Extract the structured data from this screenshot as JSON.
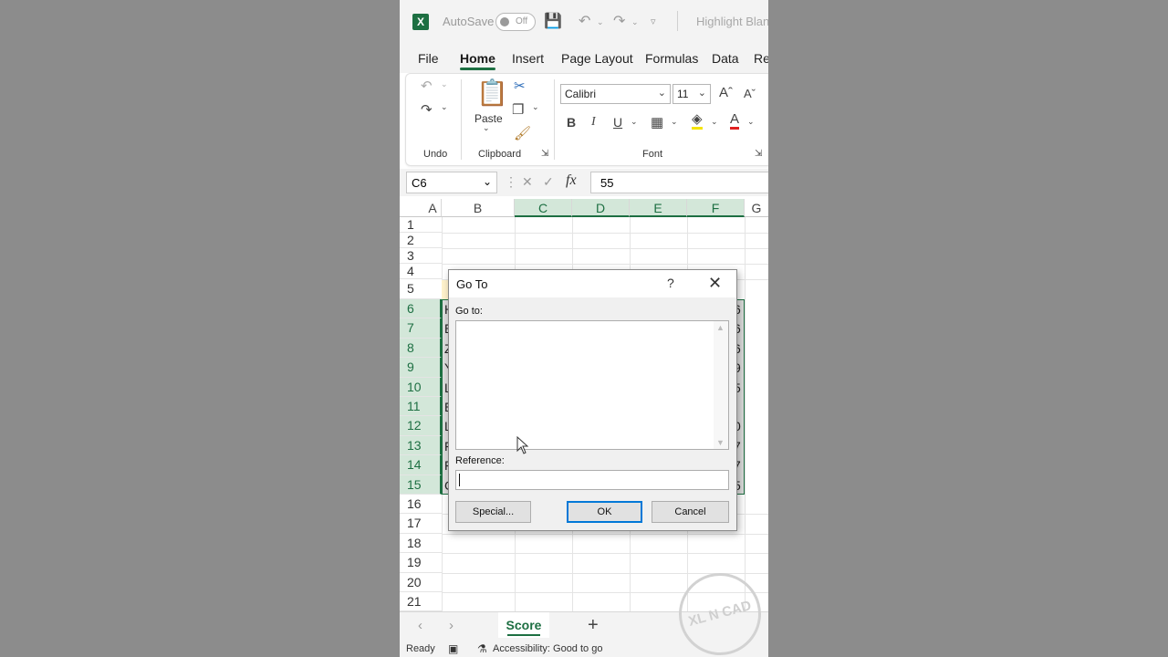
{
  "titlebar": {
    "app_icon": "excel-icon",
    "autosave_label": "AutoSave",
    "autosave_state": "Off",
    "document_title": "Highlight Blank"
  },
  "ribbon_tabs": [
    "File",
    "Home",
    "Insert",
    "Page Layout",
    "Formulas",
    "Data",
    "Re"
  ],
  "active_tab": "Home",
  "ribbon": {
    "undo_group": "Undo",
    "clipboard_group": "Clipboard",
    "paste_label": "Paste",
    "font_group": "Font",
    "font_name": "Calibri",
    "font_size": "11",
    "bold": "B",
    "italic": "I",
    "underline": "U"
  },
  "formula_bar": {
    "name_box": "C6",
    "fx": "fx",
    "value": "55"
  },
  "columns": [
    "A",
    "B",
    "C",
    "D",
    "E",
    "F",
    "G"
  ],
  "selected_columns": [
    "C",
    "D",
    "E",
    "F"
  ],
  "rows": [
    "1",
    "2",
    "3",
    "4",
    "5",
    "6",
    "7",
    "8",
    "9",
    "10",
    "11",
    "12",
    "13",
    "14",
    "15",
    "16",
    "17",
    "18",
    "19",
    "20",
    "21"
  ],
  "selected_rows": [
    "6",
    "7",
    "8",
    "9",
    "10",
    "11",
    "12",
    "13",
    "14",
    "15"
  ],
  "visible_cells": {
    "col_b": {
      "5": "",
      "6": "H",
      "7": "E",
      "8": "Z",
      "9": "Y",
      "10": "L",
      "11": "E",
      "12": "L",
      "13": "F",
      "14": "F",
      "15": "C"
    },
    "col_f": {
      "6": "6",
      "7": "6",
      "8": "6",
      "9": "9",
      "10": "5",
      "11": "",
      "12": "0",
      "13": "7",
      "14": "7",
      "15": "5"
    }
  },
  "sheet_tabs": [
    "Score"
  ],
  "active_sheet": "Score",
  "status_bar": {
    "ready": "Ready",
    "accessibility": "Accessibility: Good to go"
  },
  "watermark_text": "XL N CAD",
  "dialog": {
    "title": "Go To",
    "help": "?",
    "go_to_label": "Go to:",
    "reference_label": "Reference:",
    "reference_value": "",
    "special_button": "Special...",
    "ok_button": "OK",
    "cancel_button": "Cancel"
  },
  "colors": {
    "excel_green": "#1d6f42",
    "selection_fill": "#dcdcdc",
    "header_fill": "#fff2cc",
    "focus_blue": "#0078d7"
  }
}
